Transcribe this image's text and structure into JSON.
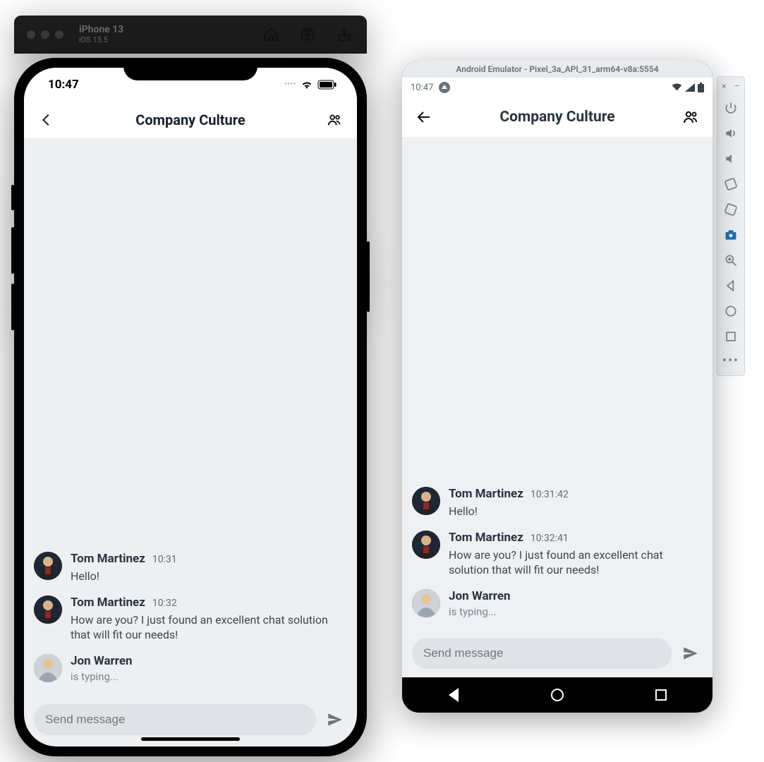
{
  "simulator": {
    "device": "iPhone 13",
    "os": "iOS 15.5"
  },
  "iphone": {
    "clock": "10:47",
    "header_title": "Company Culture",
    "messages": [
      {
        "name": "Tom Martinez",
        "time": "10:31",
        "text": "Hello!"
      },
      {
        "name": "Tom Martinez",
        "time": "10:32",
        "text": "How are you? I just found an excellent chat solution that will fit our needs!"
      }
    ],
    "typing": {
      "name": "Jon Warren",
      "text": "is typing..."
    },
    "composer_placeholder": "Send message"
  },
  "android": {
    "emulator_title": "Android Emulator - Pixel_3a_API_31_arm64-v8a:5554",
    "clock": "10:47",
    "header_title": "Company Culture",
    "messages": [
      {
        "name": "Tom Martinez",
        "time": "10:31:42",
        "text": "Hello!"
      },
      {
        "name": "Tom Martinez",
        "time": "10:32:41",
        "text": "How are you? I just found an excellent chat solution that will fit our needs!"
      }
    ],
    "typing": {
      "name": "Jon Warren",
      "text": "is typing..."
    },
    "composer_placeholder": "Send message"
  }
}
